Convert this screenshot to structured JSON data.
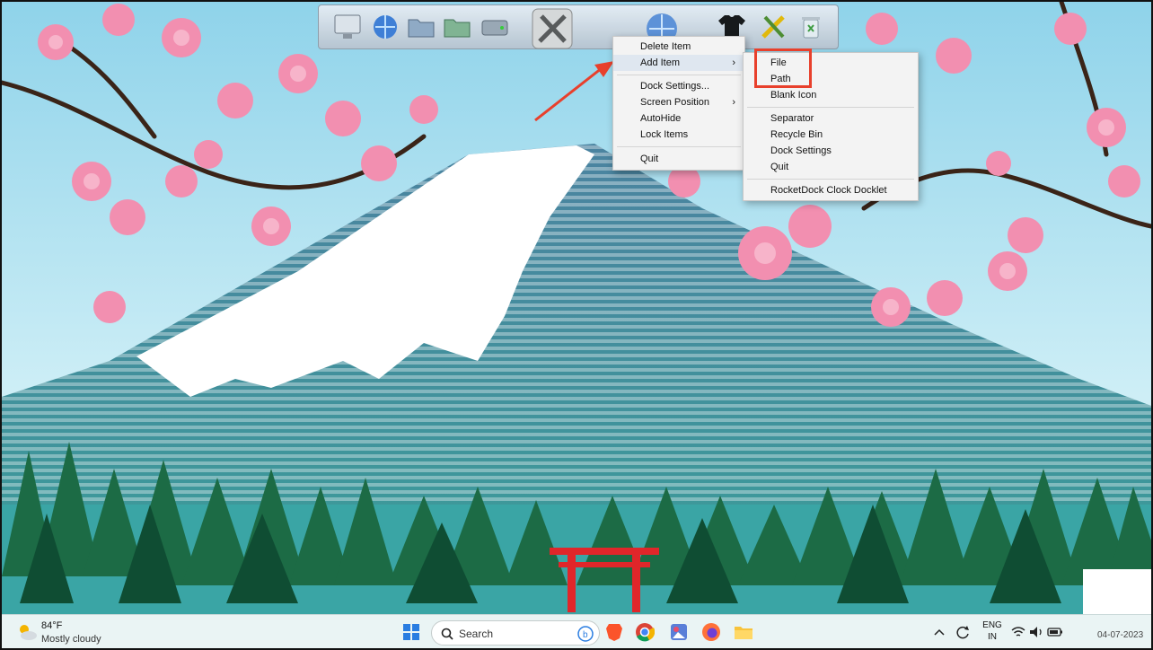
{
  "dock": {
    "icons": [
      "monitor-icon",
      "globe-network-icon",
      "folder-icon",
      "folder-green-icon",
      "drive-icon",
      "tools-icon",
      "globe-icon",
      "tshirt-icon",
      "tools-yellow-icon",
      "recycle-bin-icon"
    ]
  },
  "context_menu": {
    "items": [
      {
        "label": "Delete Item"
      },
      {
        "label": "Add Item",
        "submenu": true
      },
      {
        "label": "Dock Settings..."
      },
      {
        "label": "Screen Position",
        "submenu": true
      },
      {
        "label": "AutoHide"
      },
      {
        "label": "Lock Items"
      },
      {
        "label": "Quit"
      }
    ]
  },
  "submenu": {
    "items": [
      {
        "label": "File"
      },
      {
        "label": "Path"
      },
      {
        "label": "Blank Icon"
      },
      {
        "label": "Separator"
      },
      {
        "label": "Recycle Bin"
      },
      {
        "label": "Dock Settings"
      },
      {
        "label": "Quit"
      },
      {
        "label": "RocketDock Clock Docklet"
      }
    ]
  },
  "annotation": {
    "highlight_color": "#e8402c"
  },
  "taskbar": {
    "weather": {
      "temp": "84°F",
      "condition": "Mostly cloudy"
    },
    "search": {
      "label": "Search"
    },
    "apps": [
      "windows-start-icon",
      "brave-icon",
      "chrome-icon",
      "photos-icon",
      "firefox-icon",
      "file-explorer-icon"
    ],
    "tray": {
      "lang1": "ENG",
      "lang2": "IN",
      "clock": "04-07-2023"
    }
  },
  "colors": {
    "sky": "#bfe8f4",
    "mountain": "#5a9fb6",
    "snow": "#ffffff",
    "forest": "#1f7a4a",
    "blossom": "#f28fb0"
  }
}
